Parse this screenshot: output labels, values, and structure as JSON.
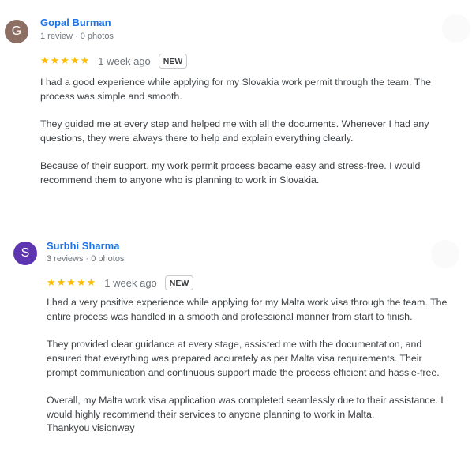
{
  "reviews": [
    {
      "avatar_letter": "G",
      "avatar_color": "#8d6e63",
      "author": "Gopal Burman",
      "meta": "1 review · 0 photos",
      "stars": "★★★★★",
      "age": "1 week ago",
      "badge": "NEW",
      "paragraphs": [
        [
          "I had a good experience while applying for my Slovakia work permit through the team. The",
          "process was simple and smooth."
        ],
        [
          "They guided me at every step and helped me with all the documents. Whenever I had any",
          "questions, they were always there to help and explain everything clearly."
        ],
        [
          "Because of their support, my work permit process became easy and stress-free. I would",
          "recommend them to anyone who is planning to work in Slovakia."
        ]
      ]
    },
    {
      "avatar_letter": "S",
      "avatar_color": "#5e35b1",
      "author": "Surbhi Sharma",
      "meta": "3 reviews · 0 photos",
      "stars": "★★★★★",
      "age": "1 week ago",
      "badge": "NEW",
      "paragraphs": [
        [
          "I had a very positive experience while applying for my Malta work visa through the team. The",
          "entire process was handled in a smooth and professional manner from start to finish."
        ],
        [
          "They provided clear guidance at every stage, assisted me with the documentation, and",
          "ensured that everything was prepared accurately as per Malta visa requirements. Their",
          "prompt communication and continuous support made the process efficient and hassle-free."
        ],
        [
          "Overall, my Malta work visa application was completed seamlessly due to their assistance. I",
          "would highly recommend their services to anyone planning to work in Malta.",
          "Thankyou visionway"
        ]
      ]
    }
  ]
}
